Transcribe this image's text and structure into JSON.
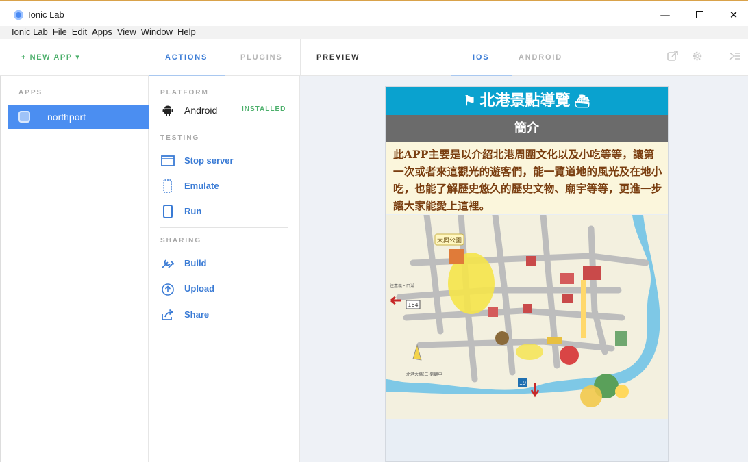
{
  "window": {
    "title": "Ionic Lab",
    "controls": {
      "minimize": "—",
      "close": "✕"
    }
  },
  "menu": [
    "Ionic Lab",
    "File",
    "Edit",
    "Apps",
    "View",
    "Window",
    "Help"
  ],
  "toolbar": {
    "new_app_label": "+ NEW APP ▾",
    "tabs": {
      "actions": "ACTIONS",
      "plugins": "PLUGINS"
    },
    "preview_label": "PREVIEW",
    "platform_tabs": {
      "ios": "IOS",
      "android": "ANDROID"
    }
  },
  "sidebar": {
    "apps_label": "APPS",
    "apps": [
      {
        "name": "northport",
        "selected": true
      }
    ]
  },
  "actions": {
    "platform_label": "PLATFORM",
    "platform": {
      "name": "Android",
      "status": "INSTALLED"
    },
    "testing_label": "TESTING",
    "testing": [
      {
        "label": "Stop server",
        "icon": "browser-window-icon"
      },
      {
        "label": "Emulate",
        "icon": "dashed-phone-icon"
      },
      {
        "label": "Run",
        "icon": "phone-icon"
      }
    ],
    "sharing_label": "SHARING",
    "sharing": [
      {
        "label": "Build",
        "icon": "wrench-icon"
      },
      {
        "label": "Upload",
        "icon": "upload-icon"
      },
      {
        "label": "Share",
        "icon": "share-icon"
      }
    ]
  },
  "phone": {
    "header_title": "北港景點導覽",
    "subheader": "簡介",
    "intro": "此APP主要是以介紹北港周圍文化以及小吃等等，讓第一次或者來這觀光的遊客們，能一覽道地的風光及在地小吃，也能了解歷史悠久的歷史文物、廟宇等等，更進一步讓大家能愛上這裡。",
    "map": {
      "labels": {
        "park": "大興公園",
        "route_sign": "164",
        "route_19": "19",
        "left_note": "往嘉義・口湖",
        "bottom_note": "北港大橋(三)到顧中"
      }
    }
  },
  "colors": {
    "accent_blue": "#3a7bd5",
    "selected_bg": "#4b8ef1",
    "installed_green": "#4caf6b",
    "header_cyan": "#0aa2cf",
    "subheader_gray": "#6b6b6b",
    "intro_text": "#7a3e10"
  }
}
